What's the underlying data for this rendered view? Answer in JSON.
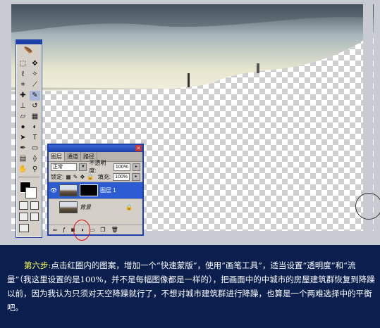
{
  "layers_panel": {
    "tabs": [
      "图层",
      "通道",
      "路径"
    ],
    "blend_mode": "正常",
    "opacity_label": "不透明度:",
    "opacity_value": "100%",
    "lock_label": "锁定:",
    "fill_label": "填充:",
    "fill_value": "100%",
    "layers": [
      {
        "name": "图层 1",
        "selected": true
      },
      {
        "name": "背景",
        "selected": false
      }
    ]
  },
  "caption": {
    "step_label": "第六步:",
    "text": "点击红圈内的图案，增加一个“快速蒙版”，使用“画笔工具”，适当设置“透明度”和“流量”（我这里设置的是100%，并不是每幅图像都是一样的），把画面中的中城市的房屋建筑群恢复到降躁以前，因为我认为只须对天空降躁就行了，不想对城市建筑群进行降躁，也算是一个两难选择中的平衡吧。"
  },
  "colors": {
    "page_bg": "#0a1f4e",
    "accent": "#1c3fa8",
    "step_color": "#ffff55",
    "highlight_circle": "#e01010"
  }
}
